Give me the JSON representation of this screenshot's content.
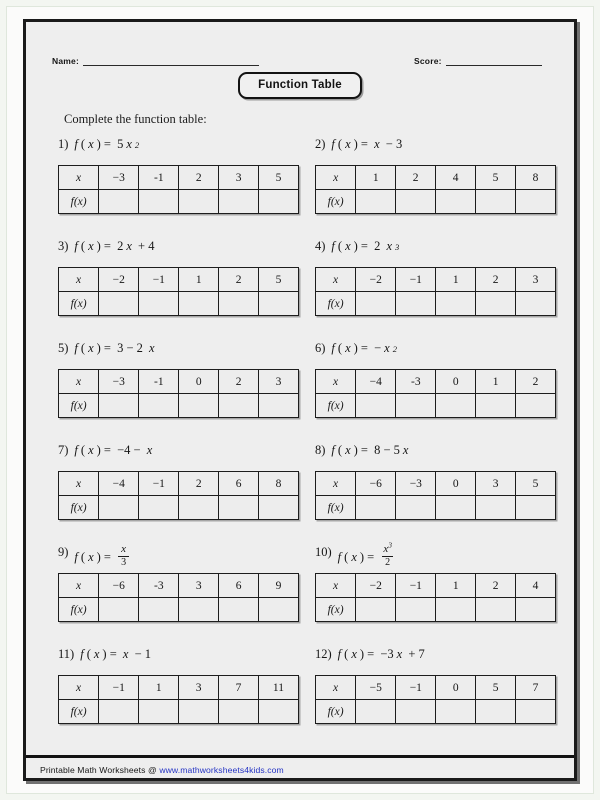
{
  "header": {
    "name_label": "Name:",
    "score_label": "Score:",
    "title": "Function Table"
  },
  "instruction": "Complete the function table:",
  "table_headers": {
    "x_row": "x",
    "fx_row": "f(x)"
  },
  "problems": [
    {
      "number": "1)",
      "expression_text": "f(x) = 5x²",
      "expr_parts": [
        {
          "t": "fn",
          "v": "f"
        },
        {
          "t": "plain",
          "v": "("
        },
        {
          "t": "mi",
          "v": "x"
        },
        {
          "t": "plain",
          "v": ") = "
        },
        {
          "t": "plain",
          "v": "5"
        },
        {
          "t": "mi",
          "v": "x"
        },
        {
          "t": "sup",
          "v": "2"
        }
      ],
      "x_values": [
        "−3",
        "-1",
        "2",
        "3",
        "5"
      ],
      "fx_values": [
        "",
        "",
        "",
        "",
        ""
      ]
    },
    {
      "number": "2)",
      "expression_text": "f(x) = x − 3",
      "expr_parts": [
        {
          "t": "fn",
          "v": "f"
        },
        {
          "t": "plain",
          "v": "("
        },
        {
          "t": "mi",
          "v": "x"
        },
        {
          "t": "plain",
          "v": ") = "
        },
        {
          "t": "mi",
          "v": "x"
        },
        {
          "t": "plain",
          "v": " − 3"
        }
      ],
      "x_values": [
        "1",
        "2",
        "4",
        "5",
        "8"
      ],
      "fx_values": [
        "",
        "",
        "",
        "",
        ""
      ]
    },
    {
      "number": "3)",
      "expression_text": "f(x) = 2x + 4",
      "expr_parts": [
        {
          "t": "fn",
          "v": "f"
        },
        {
          "t": "plain",
          "v": "("
        },
        {
          "t": "mi",
          "v": "x"
        },
        {
          "t": "plain",
          "v": ") = "
        },
        {
          "t": "plain",
          "v": "2"
        },
        {
          "t": "mi",
          "v": "x"
        },
        {
          "t": "plain",
          "v": " + 4"
        }
      ],
      "x_values": [
        "−2",
        "−1",
        "1",
        "2",
        "5"
      ],
      "fx_values": [
        "",
        "",
        "",
        "",
        ""
      ]
    },
    {
      "number": "4)",
      "expression_text": "f(x) = 2 x³",
      "expr_parts": [
        {
          "t": "fn",
          "v": "f"
        },
        {
          "t": "plain",
          "v": "("
        },
        {
          "t": "mi",
          "v": "x"
        },
        {
          "t": "plain",
          "v": ") = "
        },
        {
          "t": "plain",
          "v": "2 "
        },
        {
          "t": "mi",
          "v": "x"
        },
        {
          "t": "sup",
          "v": "3"
        }
      ],
      "x_values": [
        "−2",
        "−1",
        "1",
        "2",
        "3"
      ],
      "fx_values": [
        "",
        "",
        "",
        "",
        ""
      ]
    },
    {
      "number": "5)",
      "expression_text": "f(x) = 3 − 2 x",
      "expr_parts": [
        {
          "t": "fn",
          "v": "f"
        },
        {
          "t": "plain",
          "v": "("
        },
        {
          "t": "mi",
          "v": "x"
        },
        {
          "t": "plain",
          "v": ") = "
        },
        {
          "t": "plain",
          "v": "3 − 2 "
        },
        {
          "t": "mi",
          "v": "x"
        }
      ],
      "x_values": [
        "−3",
        "-1",
        "0",
        "2",
        "3"
      ],
      "fx_values": [
        "",
        "",
        "",
        "",
        ""
      ]
    },
    {
      "number": "6)",
      "expression_text": "f(x) = −x²",
      "expr_parts": [
        {
          "t": "fn",
          "v": "f"
        },
        {
          "t": "plain",
          "v": "("
        },
        {
          "t": "mi",
          "v": "x"
        },
        {
          "t": "plain",
          "v": ") = "
        },
        {
          "t": "plain",
          "v": "−"
        },
        {
          "t": "mi",
          "v": "x"
        },
        {
          "t": "sup",
          "v": "2"
        }
      ],
      "x_values": [
        "−4",
        "-3",
        "0",
        "1",
        "2"
      ],
      "fx_values": [
        "",
        "",
        "",
        "",
        ""
      ]
    },
    {
      "number": "7)",
      "expression_text": "f(x) = −4 − x",
      "expr_parts": [
        {
          "t": "fn",
          "v": "f"
        },
        {
          "t": "plain",
          "v": "("
        },
        {
          "t": "mi",
          "v": "x"
        },
        {
          "t": "plain",
          "v": ") = "
        },
        {
          "t": "plain",
          "v": "−4 − "
        },
        {
          "t": "mi",
          "v": "x"
        }
      ],
      "x_values": [
        "−4",
        "−1",
        "2",
        "6",
        "8"
      ],
      "fx_values": [
        "",
        "",
        "",
        "",
        ""
      ]
    },
    {
      "number": "8)",
      "expression_text": "f(x) = 8 − 5x",
      "expr_parts": [
        {
          "t": "fn",
          "v": "f"
        },
        {
          "t": "plain",
          "v": "("
        },
        {
          "t": "mi",
          "v": "x"
        },
        {
          "t": "plain",
          "v": ") = "
        },
        {
          "t": "plain",
          "v": "8 − 5"
        },
        {
          "t": "mi",
          "v": "x"
        }
      ],
      "x_values": [
        "−6",
        "−3",
        "0",
        "3",
        "5"
      ],
      "fx_values": [
        "",
        "",
        "",
        "",
        ""
      ]
    },
    {
      "number": "9)",
      "expression_text": "f(x) = x/3",
      "expr_parts": [
        {
          "t": "fn",
          "v": "f"
        },
        {
          "t": "plain",
          "v": "("
        },
        {
          "t": "mi",
          "v": "x"
        },
        {
          "t": "plain",
          "v": ") = "
        },
        {
          "t": "frac",
          "num": "x",
          "den": "3"
        }
      ],
      "x_values": [
        "−6",
        "-3",
        "3",
        "6",
        "9"
      ],
      "fx_values": [
        "",
        "",
        "",
        "",
        ""
      ]
    },
    {
      "number": "10)",
      "expression_text": "f(x) = x³/2",
      "expr_parts": [
        {
          "t": "fn",
          "v": "f"
        },
        {
          "t": "plain",
          "v": "("
        },
        {
          "t": "mi",
          "v": "x"
        },
        {
          "t": "plain",
          "v": ") = "
        },
        {
          "t": "frac",
          "num": "x",
          "num_sup": "3",
          "den": "2"
        }
      ],
      "x_values": [
        "−2",
        "−1",
        "1",
        "2",
        "4"
      ],
      "fx_values": [
        "",
        "",
        "",
        "",
        ""
      ]
    },
    {
      "number": "11)",
      "expression_text": "f(x) = x − 1",
      "expr_parts": [
        {
          "t": "fn",
          "v": "f"
        },
        {
          "t": "plain",
          "v": "("
        },
        {
          "t": "mi",
          "v": "x"
        },
        {
          "t": "plain",
          "v": ") = "
        },
        {
          "t": "mi",
          "v": "x"
        },
        {
          "t": "plain",
          "v": " − 1"
        }
      ],
      "x_values": [
        "−1",
        "1",
        "3",
        "7",
        "11"
      ],
      "fx_values": [
        "",
        "",
        "",
        "",
        ""
      ]
    },
    {
      "number": "12)",
      "expression_text": "f(x) = −3x + 7",
      "expr_parts": [
        {
          "t": "fn",
          "v": "f"
        },
        {
          "t": "plain",
          "v": "("
        },
        {
          "t": "mi",
          "v": "x"
        },
        {
          "t": "plain",
          "v": ") = "
        },
        {
          "t": "plain",
          "v": "−3"
        },
        {
          "t": "mi",
          "v": "x"
        },
        {
          "t": "plain",
          "v": " + 7"
        }
      ],
      "x_values": [
        "−5",
        "−1",
        "0",
        "5",
        "7"
      ],
      "fx_values": [
        "",
        "",
        "",
        "",
        ""
      ]
    }
  ],
  "footer": {
    "text": "Printable Math Worksheets @ ",
    "url": "www.mathworksheets4kids.com",
    "url_color": "#2433c4"
  }
}
